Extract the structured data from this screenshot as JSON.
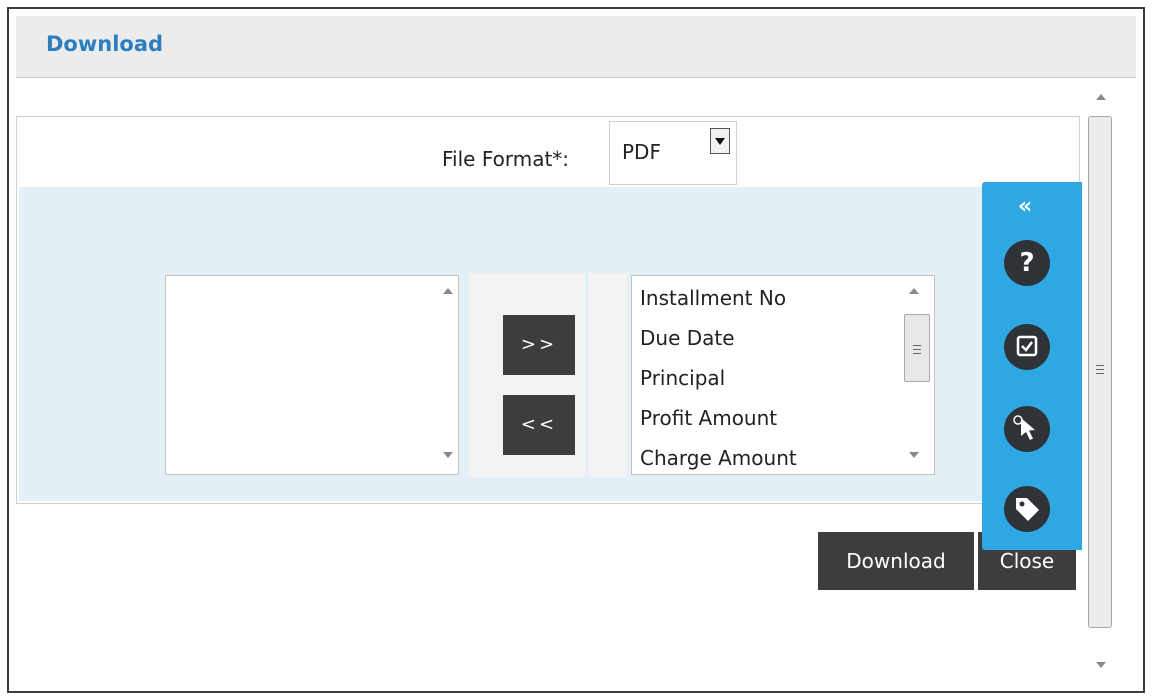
{
  "dialog": {
    "title": "Download"
  },
  "form": {
    "file_format_label": "File Format*:",
    "file_format_value": "PDF"
  },
  "available_list": {
    "items": []
  },
  "selected_list": {
    "items": [
      "Installment No",
      "Due Date",
      "Principal",
      "Profit Amount",
      "Charge Amount"
    ]
  },
  "transfer": {
    "add_label": ">>",
    "remove_label": "<<"
  },
  "actions": {
    "download_label": "Download",
    "close_label": "Close"
  },
  "side_toolbar": {
    "collapse_glyph": "«",
    "icons": [
      "help-icon",
      "checkbox-icon",
      "pointer-icon",
      "tag-icon"
    ]
  },
  "colors": {
    "accent": "#2c7fbf",
    "toolbar": "#2ea8e2",
    "button": "#3d3d3d",
    "panel": "#e4eff6"
  }
}
